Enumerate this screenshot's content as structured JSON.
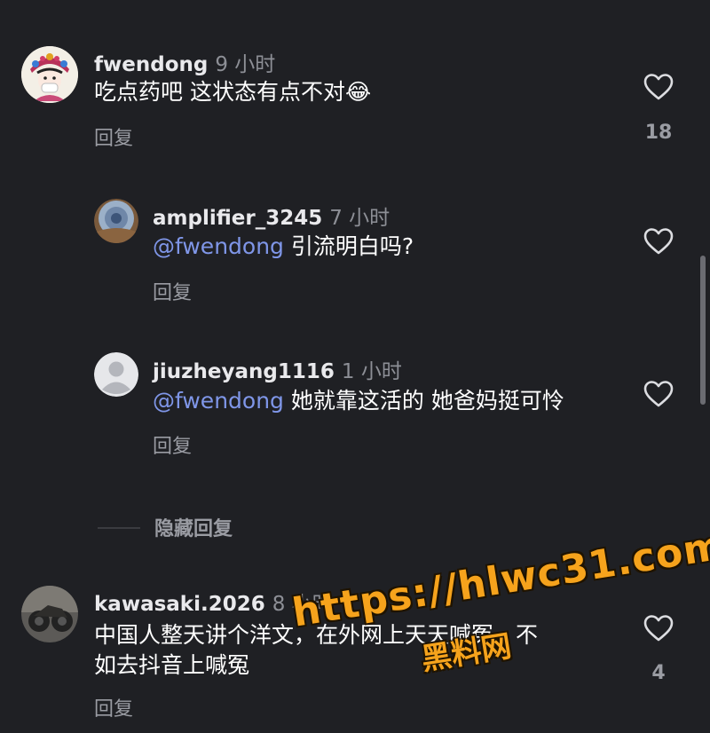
{
  "comments": [
    {
      "username": "fwendong",
      "time": "9 小时",
      "text": "吃点药吧 这状态有点不对😂",
      "reply_label": "回复",
      "likes": "18",
      "avatar": "avatar-opera-costume"
    },
    {
      "username": "amplifier_3245",
      "time": "7 小时",
      "mention": "@fwendong",
      "text": " 引流明白吗?",
      "reply_label": "回复",
      "avatar": "avatar-dome-photo"
    },
    {
      "username": "jiuzheyang1116",
      "time": "1 小时",
      "mention": "@fwendong",
      "text": " 她就靠这活的 她爸妈挺可怜",
      "reply_label": "回复",
      "avatar": "avatar-default"
    },
    {
      "username": "kawasaki.2026",
      "time": "8 小时",
      "text_line1": "中国人整天讲个洋文，在外网上天天喊冤，不",
      "text_line2": "如去抖音上喊冤",
      "reply_label": "回复",
      "likes": "4",
      "avatar": "avatar-motorcycle"
    }
  ],
  "hidden_replies_label": "隐藏回复",
  "watermark": {
    "url": "https://hlwc31.com",
    "name": "黑料网"
  },
  "colors": {
    "background": "#1f2024",
    "mention": "#7f96e8",
    "muted": "#9a9ca3",
    "watermark": "#f6a31c"
  },
  "icons": [
    "heart-outline-icon",
    "default-avatar-icon"
  ]
}
